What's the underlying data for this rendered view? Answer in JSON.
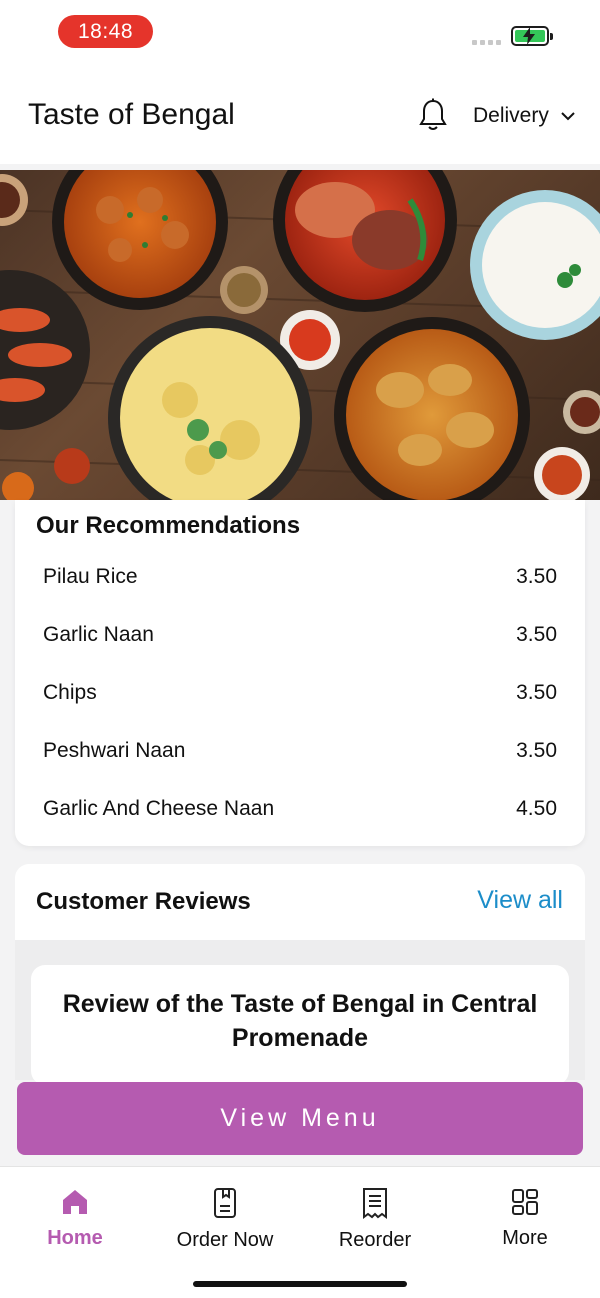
{
  "status_bar": {
    "time": "18:48",
    "battery_icon": "battery-charging-icon",
    "signal_icon": "signal-icon"
  },
  "header": {
    "title": "Taste of Bengal",
    "notification_icon": "bell-icon",
    "mode_label": "Delivery",
    "mode_icon": "chevron-down-icon"
  },
  "recommendations": {
    "title": "Our Recommendations",
    "items": [
      {
        "name": "Pilau Rice",
        "price": "3.50"
      },
      {
        "name": "Garlic Naan",
        "price": "3.50"
      },
      {
        "name": "Chips",
        "price": "3.50"
      },
      {
        "name": "Peshwari Naan",
        "price": "3.50"
      },
      {
        "name": "Garlic And Cheese Naan",
        "price": "4.50"
      }
    ]
  },
  "reviews": {
    "title": "Customer Reviews",
    "view_all": "View all",
    "card_title": "Review of the Taste of Bengal in Central Promenade"
  },
  "cta": {
    "view_menu": "View Menu"
  },
  "bottom_nav": {
    "items": [
      {
        "label": "Home",
        "icon": "home-icon",
        "active": true
      },
      {
        "label": "Order Now",
        "icon": "order-document-icon",
        "active": false
      },
      {
        "label": "Reorder",
        "icon": "receipt-icon",
        "active": false
      },
      {
        "label": "More",
        "icon": "grid-icon",
        "active": false
      }
    ]
  },
  "colors": {
    "accent": "#b55bb0",
    "link": "#1c8dc9",
    "time_pill": "#e5342b",
    "battery": "#34c759"
  }
}
